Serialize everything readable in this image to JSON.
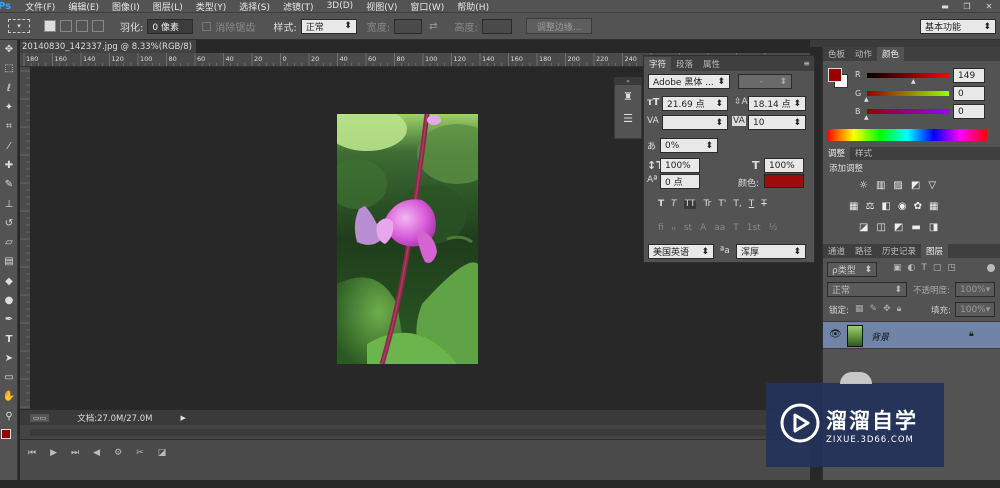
{
  "app": {
    "logo": "Ps"
  },
  "menu": [
    "文件(F)",
    "编辑(E)",
    "图像(I)",
    "图层(L)",
    "类型(Y)",
    "选择(S)",
    "滤镜(T)",
    "3D(D)",
    "视图(V)",
    "窗口(W)",
    "帮助(H)"
  ],
  "options_bar": {
    "feather_label": "羽化:",
    "feather_value": "0 像素",
    "antialias_label": "消除锯齿",
    "style_label": "样式:",
    "style_value": "正常",
    "width_label": "宽度:",
    "height_label": "高度:",
    "refine_edge_button": "调整边缘...",
    "workspace": "基本功能"
  },
  "document": {
    "tab_title": "20140830_142337.jpg @ 8.33%(RGB/8)",
    "close_glyph": "×",
    "ruler_marks": [
      "180",
      "160",
      "140",
      "120",
      "100",
      "80",
      "60",
      "40",
      "20",
      "0",
      "20",
      "40",
      "60",
      "80",
      "100",
      "120",
      "140",
      "160",
      "180",
      "200",
      "220",
      "240",
      "260",
      "280",
      "300",
      "320",
      "340"
    ],
    "status_text": "文档:27.0M/27.0M",
    "zoom": "8.33%"
  },
  "character_panel": {
    "tabs": [
      "字符",
      "段落",
      "属性"
    ],
    "font_family": "Adobe 黑体 ...",
    "font_style": "-",
    "font_size": "21.69 点",
    "leading": "18.14 点",
    "kerning": "",
    "tracking": "10",
    "tsume": "0%",
    "vertical_scale": "100%",
    "horizontal_scale": "100%",
    "baseline_shift": "0 点",
    "color_label": "颜色:",
    "text_color": "#9e0b0b",
    "style_buttons": [
      "T",
      "T",
      "TT",
      "Tr",
      "T'",
      "T,",
      "T",
      "T"
    ],
    "opentype_buttons": [
      "fi",
      "ℴ",
      "st",
      "A",
      "aa",
      "T",
      "1st",
      "½"
    ],
    "language": "美国英语",
    "aa_label": "ªa",
    "antialias": "浑厚"
  },
  "color_panel": {
    "tabs": [
      "色板",
      "动作",
      "颜色"
    ],
    "r_label": "R",
    "g_label": "G",
    "b_label": "B",
    "r": "149",
    "g": "0",
    "b": "0",
    "foreground": "#950000"
  },
  "adjustments_panel": {
    "tabs": [
      "调整",
      "样式"
    ],
    "title": "添加调整"
  },
  "layers_panel": {
    "tabs": [
      "通道",
      "路径",
      "历史记录",
      "图层"
    ],
    "kind_label": "ρ类型",
    "blend_mode": "正常",
    "opacity_label": "不透明度:",
    "opacity": "100%",
    "lock_label": "锁定:",
    "fill_label": "填充:",
    "fill": "100%",
    "layer_name": "背景"
  },
  "watermark": {
    "brand": "溜溜自学",
    "url": "ZIXUE.3D66.COM"
  }
}
